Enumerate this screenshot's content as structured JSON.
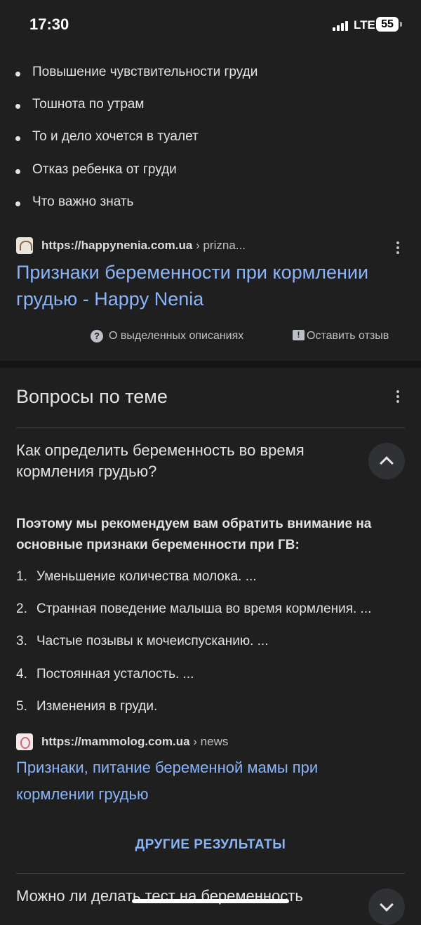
{
  "status": {
    "time": "17:30",
    "network": "LTE",
    "battery": "55"
  },
  "bullets": [
    "Повышение чувствительности груди",
    "Тошнота по утрам",
    "То и дело хочется в туалет",
    "Отказ ребенка от груди",
    "Что важно знать"
  ],
  "result1": {
    "url_host": "https://happynenia.com.ua",
    "url_path": " › prizna...",
    "title_line1": "Признаки беременности при кормлении",
    "title_line2": "грудью - Happy Nenia"
  },
  "feedback": {
    "about": "О выделенных описаниях",
    "leave": "Оставить отзыв"
  },
  "paa": {
    "heading": "Вопросы по теме",
    "q1_line1": "Как определить беременность во время",
    "q1_line2": "кормления грудью?",
    "answer_line1": "Поэтому мы рекомендуем вам обратить внимание на",
    "answer_line2": "основные признаки беременности при ГВ:",
    "list": [
      "Уменьшение количества молока. ...",
      "Странная поведение малыша во время кормления. ...",
      "Частые позывы к мочеиспусканию. ...",
      "Постоянная усталость. ...",
      "Изменения в груди."
    ],
    "list_numbers": [
      "1.",
      "2.",
      "3.",
      "4.",
      "5."
    ],
    "source": {
      "url_host": "https://mammolog.com.ua",
      "url_path": " › news",
      "title_line1": "Признаки, питание беременной мамы при",
      "title_line2": "кормлении грудью"
    },
    "more": "ДРУГИЕ РЕЗУЛЬТАТЫ",
    "q2_partial": "Можно ли делать тест на беременность"
  }
}
